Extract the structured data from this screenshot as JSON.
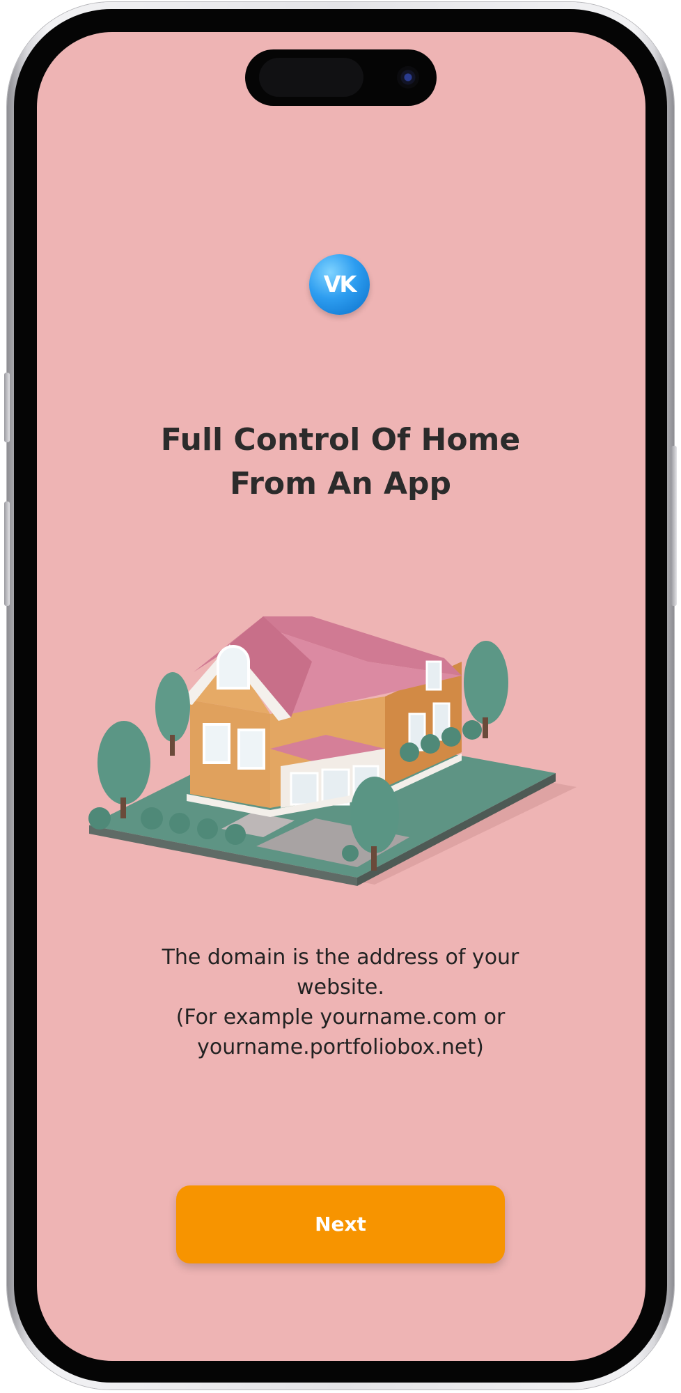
{
  "onboarding": {
    "logo_text": "VK",
    "title_line1": "Full Control Of Home",
    "title_line2": "From An App",
    "description_line1": "The domain is the address of your",
    "description_line2": "website.",
    "description_line3": "(For example yourname.com or",
    "description_line4": "yourname.portfoliobox.net)",
    "next_label": "Next"
  },
  "colors": {
    "screen_background": "#eeb4b4",
    "button_background": "#f79400",
    "title_text": "#2b2b2b",
    "logo_blue": "#2d9df0"
  },
  "icons": {
    "logo": "vk-logo-icon",
    "illustration": "house-illustration"
  }
}
